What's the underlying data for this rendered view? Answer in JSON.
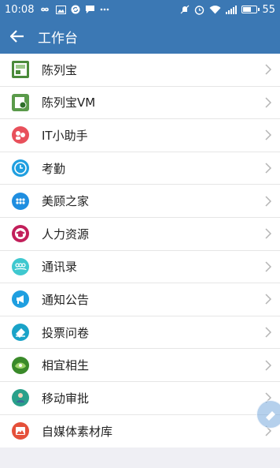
{
  "status_bar": {
    "time": "10:08",
    "battery": "55",
    "left_icons": [
      "infinity-icon",
      "image-icon",
      "sync-icon",
      "message-icon",
      "more-dots-icon"
    ],
    "right_icons": [
      "mute-icon",
      "alarm-icon",
      "wifi-icon",
      "signal-icon",
      "battery-icon"
    ]
  },
  "header": {
    "title": "工作台",
    "back_icon": "arrow-left-icon"
  },
  "menu": {
    "items": [
      {
        "label": "陈列宝",
        "icon": "chenliebao-icon",
        "color": "#4a8a3a"
      },
      {
        "label": "陈列宝VM",
        "icon": "chenliebao-vm-icon",
        "color": "#5a9a4a"
      },
      {
        "label": "IT小助手",
        "icon": "it-helper-icon",
        "color": "#e8505b"
      },
      {
        "label": "考勤",
        "icon": "clock-icon",
        "color": "#1f9fe0"
      },
      {
        "label": "美顾之家",
        "icon": "community-icon",
        "color": "#1f8ee0"
      },
      {
        "label": "人力资源",
        "icon": "graduation-cap-icon",
        "color": "#c21f5a"
      },
      {
        "label": "通讯录",
        "icon": "contacts-icon",
        "color": "#3fc8cf"
      },
      {
        "label": "通知公告",
        "icon": "megaphone-icon",
        "color": "#1f9fe0"
      },
      {
        "label": "投票问卷",
        "icon": "vote-icon",
        "color": "#1aa3c8"
      },
      {
        "label": "相宜相生",
        "icon": "xiangyi-icon",
        "color": "#3a8a2a"
      },
      {
        "label": "移动审批",
        "icon": "approval-icon",
        "color": "#2aa08a"
      },
      {
        "label": "自媒体素材库",
        "icon": "media-library-icon",
        "color": "#e5503a"
      }
    ]
  },
  "floating": {
    "icon": "assistive-touch-icon"
  }
}
